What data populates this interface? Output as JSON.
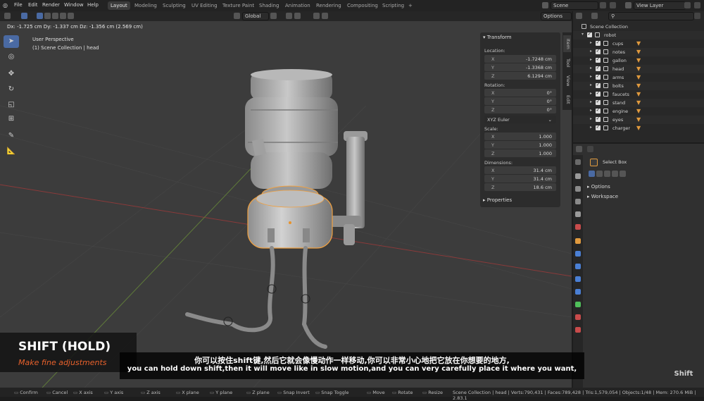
{
  "menu": [
    "File",
    "Edit",
    "Render",
    "Window",
    "Help"
  ],
  "workspaces": [
    {
      "label": "Layout",
      "active": true
    },
    {
      "label": "Modeling",
      "active": false
    },
    {
      "label": "Sculpting",
      "active": false
    },
    {
      "label": "UV Editing",
      "active": false
    },
    {
      "label": "Texture Paint",
      "active": false
    },
    {
      "label": "Shading",
      "active": false
    },
    {
      "label": "Animation",
      "active": false
    },
    {
      "label": "Rendering",
      "active": false
    },
    {
      "label": "Compositing",
      "active": false
    },
    {
      "label": "Scripting",
      "active": false
    }
  ],
  "add_tab": "+",
  "scene": "Scene",
  "view_layer": "View Layer",
  "header": {
    "transform_orientation": "Global",
    "options": "Options",
    "delta": "Dx: -1.725 cm  Dy: -1.337 cm  Dz: -1.356 cm (2.569 cm)"
  },
  "viewport": {
    "perspective": "User Perspective",
    "collection": "(1) Scene Collection | head"
  },
  "npanel": {
    "title": "Transform",
    "location_label": "Location:",
    "location": [
      {
        "axis": "X",
        "value": "-1.7248 cm"
      },
      {
        "axis": "Y",
        "value": "-1.3368 cm"
      },
      {
        "axis": "Z",
        "value": "6.1294 cm"
      }
    ],
    "rotation_label": "Rotation:",
    "rotation": [
      {
        "axis": "X",
        "value": "0°"
      },
      {
        "axis": "Y",
        "value": "0°"
      },
      {
        "axis": "Z",
        "value": "0°"
      }
    ],
    "euler": "XYZ Euler",
    "scale_label": "Scale:",
    "scale": [
      {
        "axis": "X",
        "value": "1.000"
      },
      {
        "axis": "Y",
        "value": "1.000"
      },
      {
        "axis": "Z",
        "value": "1.000"
      }
    ],
    "dimensions_label": "Dimensions:",
    "dimensions": [
      {
        "axis": "X",
        "value": "31.4 cm"
      },
      {
        "axis": "Y",
        "value": "31.4 cm"
      },
      {
        "axis": "Z",
        "value": "18.6 cm"
      }
    ],
    "properties": "Properties",
    "tabs": [
      "Item",
      "Tool",
      "View",
      "Edit"
    ]
  },
  "outliner": {
    "root": "Scene Collection",
    "collection": "robot",
    "items": [
      "cups",
      "notes",
      "gallon",
      "head",
      "arms",
      "bolts",
      "faucets",
      "stand",
      "engine",
      "eyes",
      "charger"
    ]
  },
  "properties": {
    "tool": "Select Box",
    "options": "Options",
    "workspace": "Workspace"
  },
  "status": {
    "items": [
      {
        "label": "Confirm"
      },
      {
        "label": "Cancel"
      },
      {
        "label": "X axis"
      },
      {
        "label": "Y axis"
      },
      {
        "label": "Z axis"
      },
      {
        "label": "X plane"
      },
      {
        "label": "Y plane"
      },
      {
        "label": "Z plane"
      },
      {
        "label": "Snap Invert"
      },
      {
        "label": "Snap Toggle"
      },
      {
        "label": "Move"
      },
      {
        "label": "Rotate"
      },
      {
        "label": "Resize"
      }
    ],
    "stats": "Scene Collection | head | Verts:790,431 | Faces:789,428 | Tris:1,579,054 | Objects:1/48 | Mem: 270.6 MiB | 2.83.1"
  },
  "overlay": {
    "shift_title": "SHIFT (HOLD)",
    "shift_subtitle": "Make fine adjustments",
    "subtitle_zh": "你可以按住shift键,然后它就会像慢动作一样移动,你可以非常小心地把它放在你想要的地方,",
    "subtitle_en": "you can hold down shift,then it will move like in slow motion,and you can very carefully place it where you want,",
    "key": "Shift"
  },
  "colors": {
    "accent": "#4a6aa3",
    "modifier": "#e09a3e",
    "overlay_orange": "#e8612c"
  }
}
